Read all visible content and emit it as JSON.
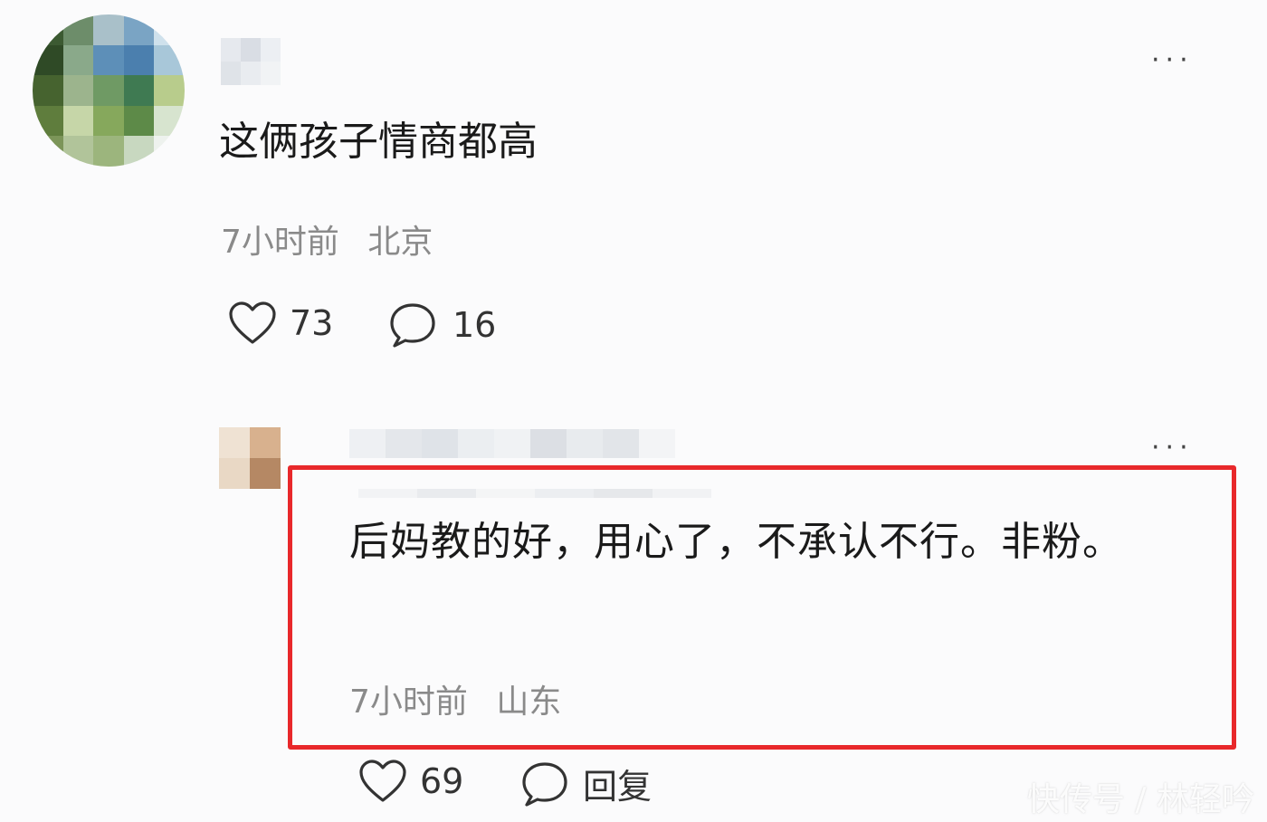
{
  "comment": {
    "text": "这俩孩子情商都高",
    "time": "7小时前",
    "location": "北京",
    "like_count": "73",
    "reply_count": "16",
    "more_label": "···"
  },
  "reply": {
    "text": "后妈教的好，用心了，不承认不行。非粉。",
    "time": "7小时前",
    "location": "山东",
    "like_count": "69",
    "reply_label": "回复",
    "more_label": "···",
    "highlight_color": "#e8282b"
  },
  "watermark": {
    "text": "快传号 / 林轻吟"
  },
  "icons": [
    "heart-icon",
    "comment-bubble-icon",
    "more-icon"
  ]
}
